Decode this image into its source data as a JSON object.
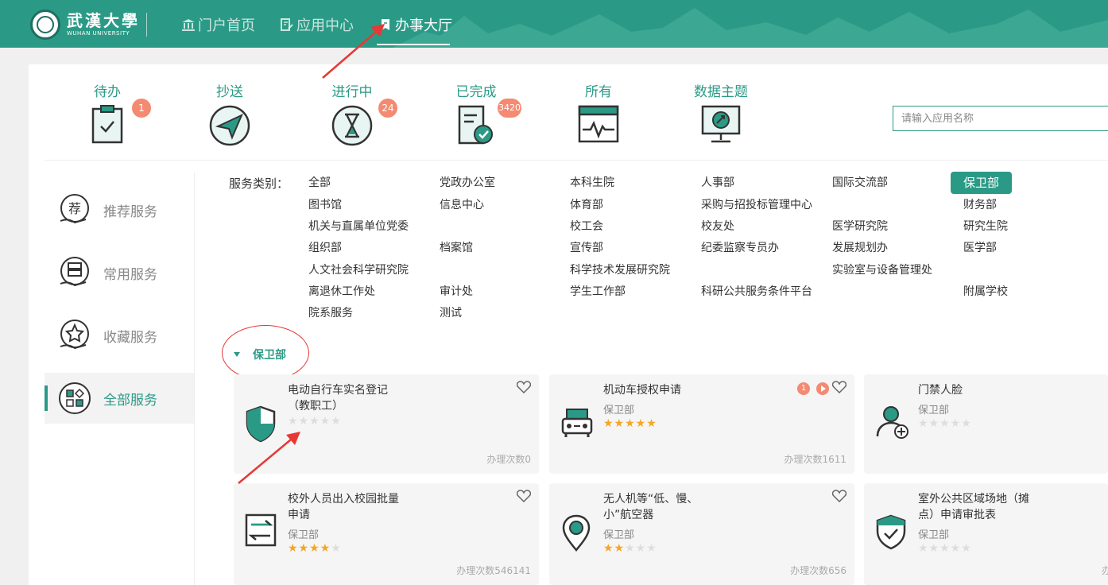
{
  "header": {
    "logo_cn": "武漢大學",
    "logo_en": "WUHAN UNIVERSITY",
    "nav": [
      {
        "label": "门户首页",
        "active": false
      },
      {
        "label": "应用中心",
        "active": false
      },
      {
        "label": "办事大厅",
        "active": true
      }
    ]
  },
  "status_tabs": [
    {
      "label": "待办",
      "badge": "1",
      "icon": "clipboard-check-icon"
    },
    {
      "label": "抄送",
      "badge": "",
      "icon": "paper-plane-icon"
    },
    {
      "label": "进行中",
      "badge": "24",
      "icon": "hourglass-icon"
    },
    {
      "label": "已完成",
      "badge": "3420",
      "icon": "document-check-icon"
    },
    {
      "label": "所有",
      "badge": "",
      "icon": "pulse-window-icon"
    },
    {
      "label": "数据主题",
      "badge": "",
      "icon": "monitor-chart-icon"
    }
  ],
  "search": {
    "placeholder": "请输入应用名称",
    "value": ""
  },
  "sidebar": {
    "items": [
      {
        "label": "推荐服务",
        "icon": "recommend-hand-icon",
        "active": false
      },
      {
        "label": "常用服务",
        "icon": "server-hand-icon",
        "active": false
      },
      {
        "label": "收藏服务",
        "icon": "star-hand-icon",
        "active": false
      },
      {
        "label": "全部服务",
        "icon": "grid-apps-icon",
        "active": true
      }
    ]
  },
  "categories": {
    "label": "服务类别：",
    "items": [
      "全部",
      "党政办公室",
      "本科生院",
      "人事部",
      "国际交流部",
      "保卫部",
      "图书馆",
      "信息中心",
      "体育部",
      "采购与招投标管理中心",
      "财务部",
      "机关与直属单位党委",
      "校工会",
      "校友处",
      "医学研究院",
      "研究生院",
      "组织部",
      "档案馆",
      "宣传部",
      "纪委监察专员办",
      "发展规划办",
      "医学部",
      "人文社会科学研究院",
      "科学技术发展研究院",
      "实验室与设备管理处",
      "离退休工作处",
      "审计处",
      "学生工作部",
      "科研公共服务条件平台",
      "附属学校",
      "院系服务",
      "测试"
    ],
    "selected": "保卫部"
  },
  "group": {
    "title": "保卫部"
  },
  "cards": [
    {
      "title": "电动自行车实名登记（教职工）",
      "title_l1": "电动自行车实名登记",
      "title_l2": "（教职工）",
      "dept": "",
      "rating": 0,
      "count": "办理次数0",
      "icon": "shield-icon",
      "badges": false
    },
    {
      "title": "机动车授权申请",
      "title_l1": "机动车授权申请",
      "title_l2": "",
      "dept": "保卫部",
      "rating": 5,
      "count": "办理次数1611",
      "icon": "car-icon",
      "badges": true,
      "badge_num": "1"
    },
    {
      "title": "门禁人脸",
      "title_l1": "门禁人脸",
      "title_l2": "",
      "dept": "保卫部",
      "rating": 0,
      "count": "",
      "icon": "user-add-icon",
      "badges": false
    },
    {
      "title": "校外人员出入校园批量申请",
      "title_l1": "校外人员出入校园批量",
      "title_l2": "申请",
      "dept": "保卫部",
      "rating": 4,
      "count": "办理次数546141",
      "icon": "exchange-icon",
      "badges": false
    },
    {
      "title": "无人机等“低、慢、小”航空器",
      "title_l1": "无人机等“低、慢、",
      "title_l2": "小”航空器",
      "dept": "保卫部",
      "rating": 2,
      "count": "办理次数656",
      "icon": "location-pin-icon",
      "badges": false
    },
    {
      "title": "室外公共区域场地（摊点）申请审批表",
      "title_l1": "室外公共区域场地（摊",
      "title_l2": "点）申请审批表",
      "dept": "保卫部",
      "rating": 0,
      "count": "办",
      "icon": "shield-check-icon",
      "badges": false
    }
  ],
  "colors": {
    "brand": "#2a9a86",
    "badge": "#f38a72",
    "star": "#f5a623",
    "annotation": "#e53935"
  }
}
